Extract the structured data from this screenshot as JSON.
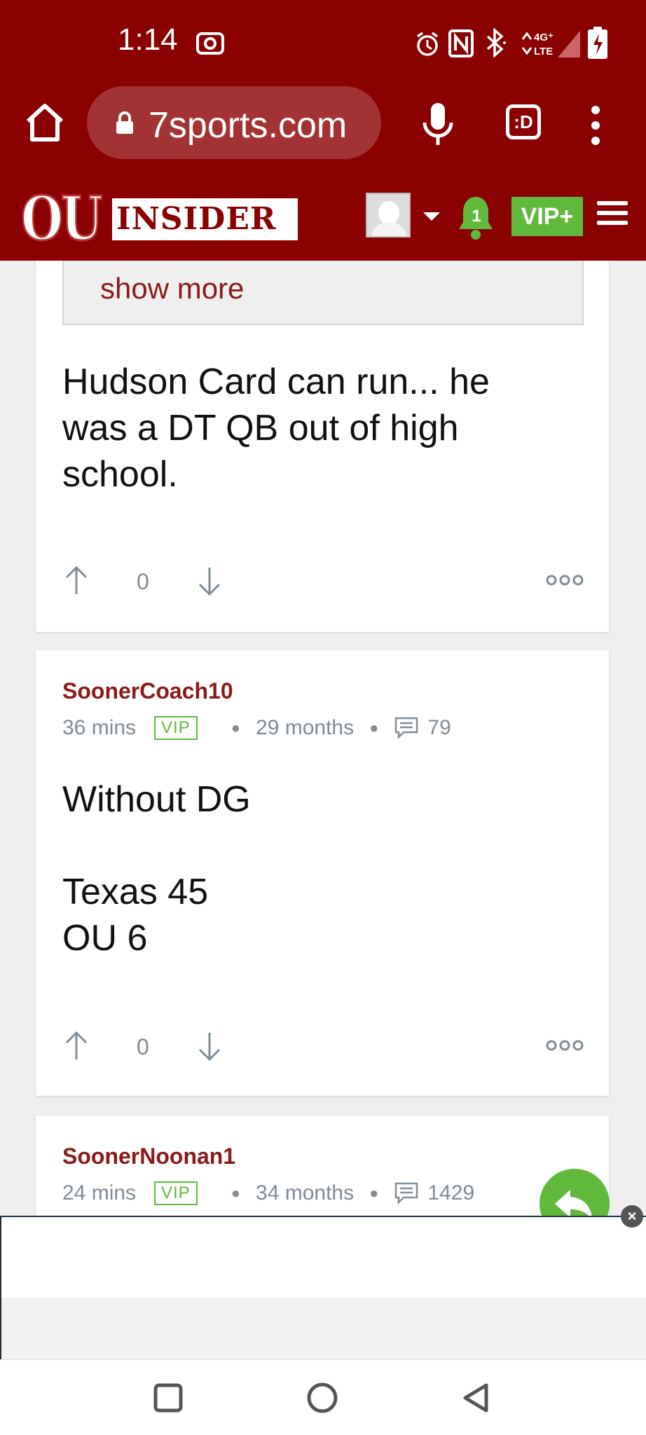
{
  "status_bar": {
    "time": "1:14",
    "network": "4G+ LTE"
  },
  "browser": {
    "url": "7sports.com",
    "tabs_label": ":D"
  },
  "site_header": {
    "logo_ou": "OU",
    "logo_insider": "INSIDER",
    "notification_count": "1",
    "vip_plus_label": "VIP+"
  },
  "posts": [
    {
      "show_more_label": "show more",
      "text": "Hudson Card can run... he\nwas a DT QB out of high\nschool.",
      "votes": "0"
    },
    {
      "author": "SoonerCoach10",
      "time_ago": "36 mins",
      "badge": "VIP",
      "member_for": "29 months",
      "comment_count": "79",
      "text": "Without DG\n\nTexas 45\nOU 6",
      "votes": "0"
    },
    {
      "author": "SoonerNoonan1",
      "time_ago": "24 mins",
      "badge": "VIP",
      "member_for": "34 months",
      "comment_count": "1429"
    }
  ],
  "colors": {
    "brand": "#8b0000",
    "accent_green": "#61b93b",
    "author_red": "#8b1a1a",
    "meta_gray": "#7f8c96"
  },
  "icons": [
    "home-icon",
    "lock-icon",
    "mic-icon",
    "tabs-icon",
    "more-vert-icon",
    "bell-icon",
    "hamburger-icon",
    "upvote-icon",
    "downvote-icon",
    "more-options-icon",
    "comment-icon",
    "reply-icon",
    "close-icon",
    "square-nav-icon",
    "circle-nav-icon",
    "back-nav-icon"
  ]
}
